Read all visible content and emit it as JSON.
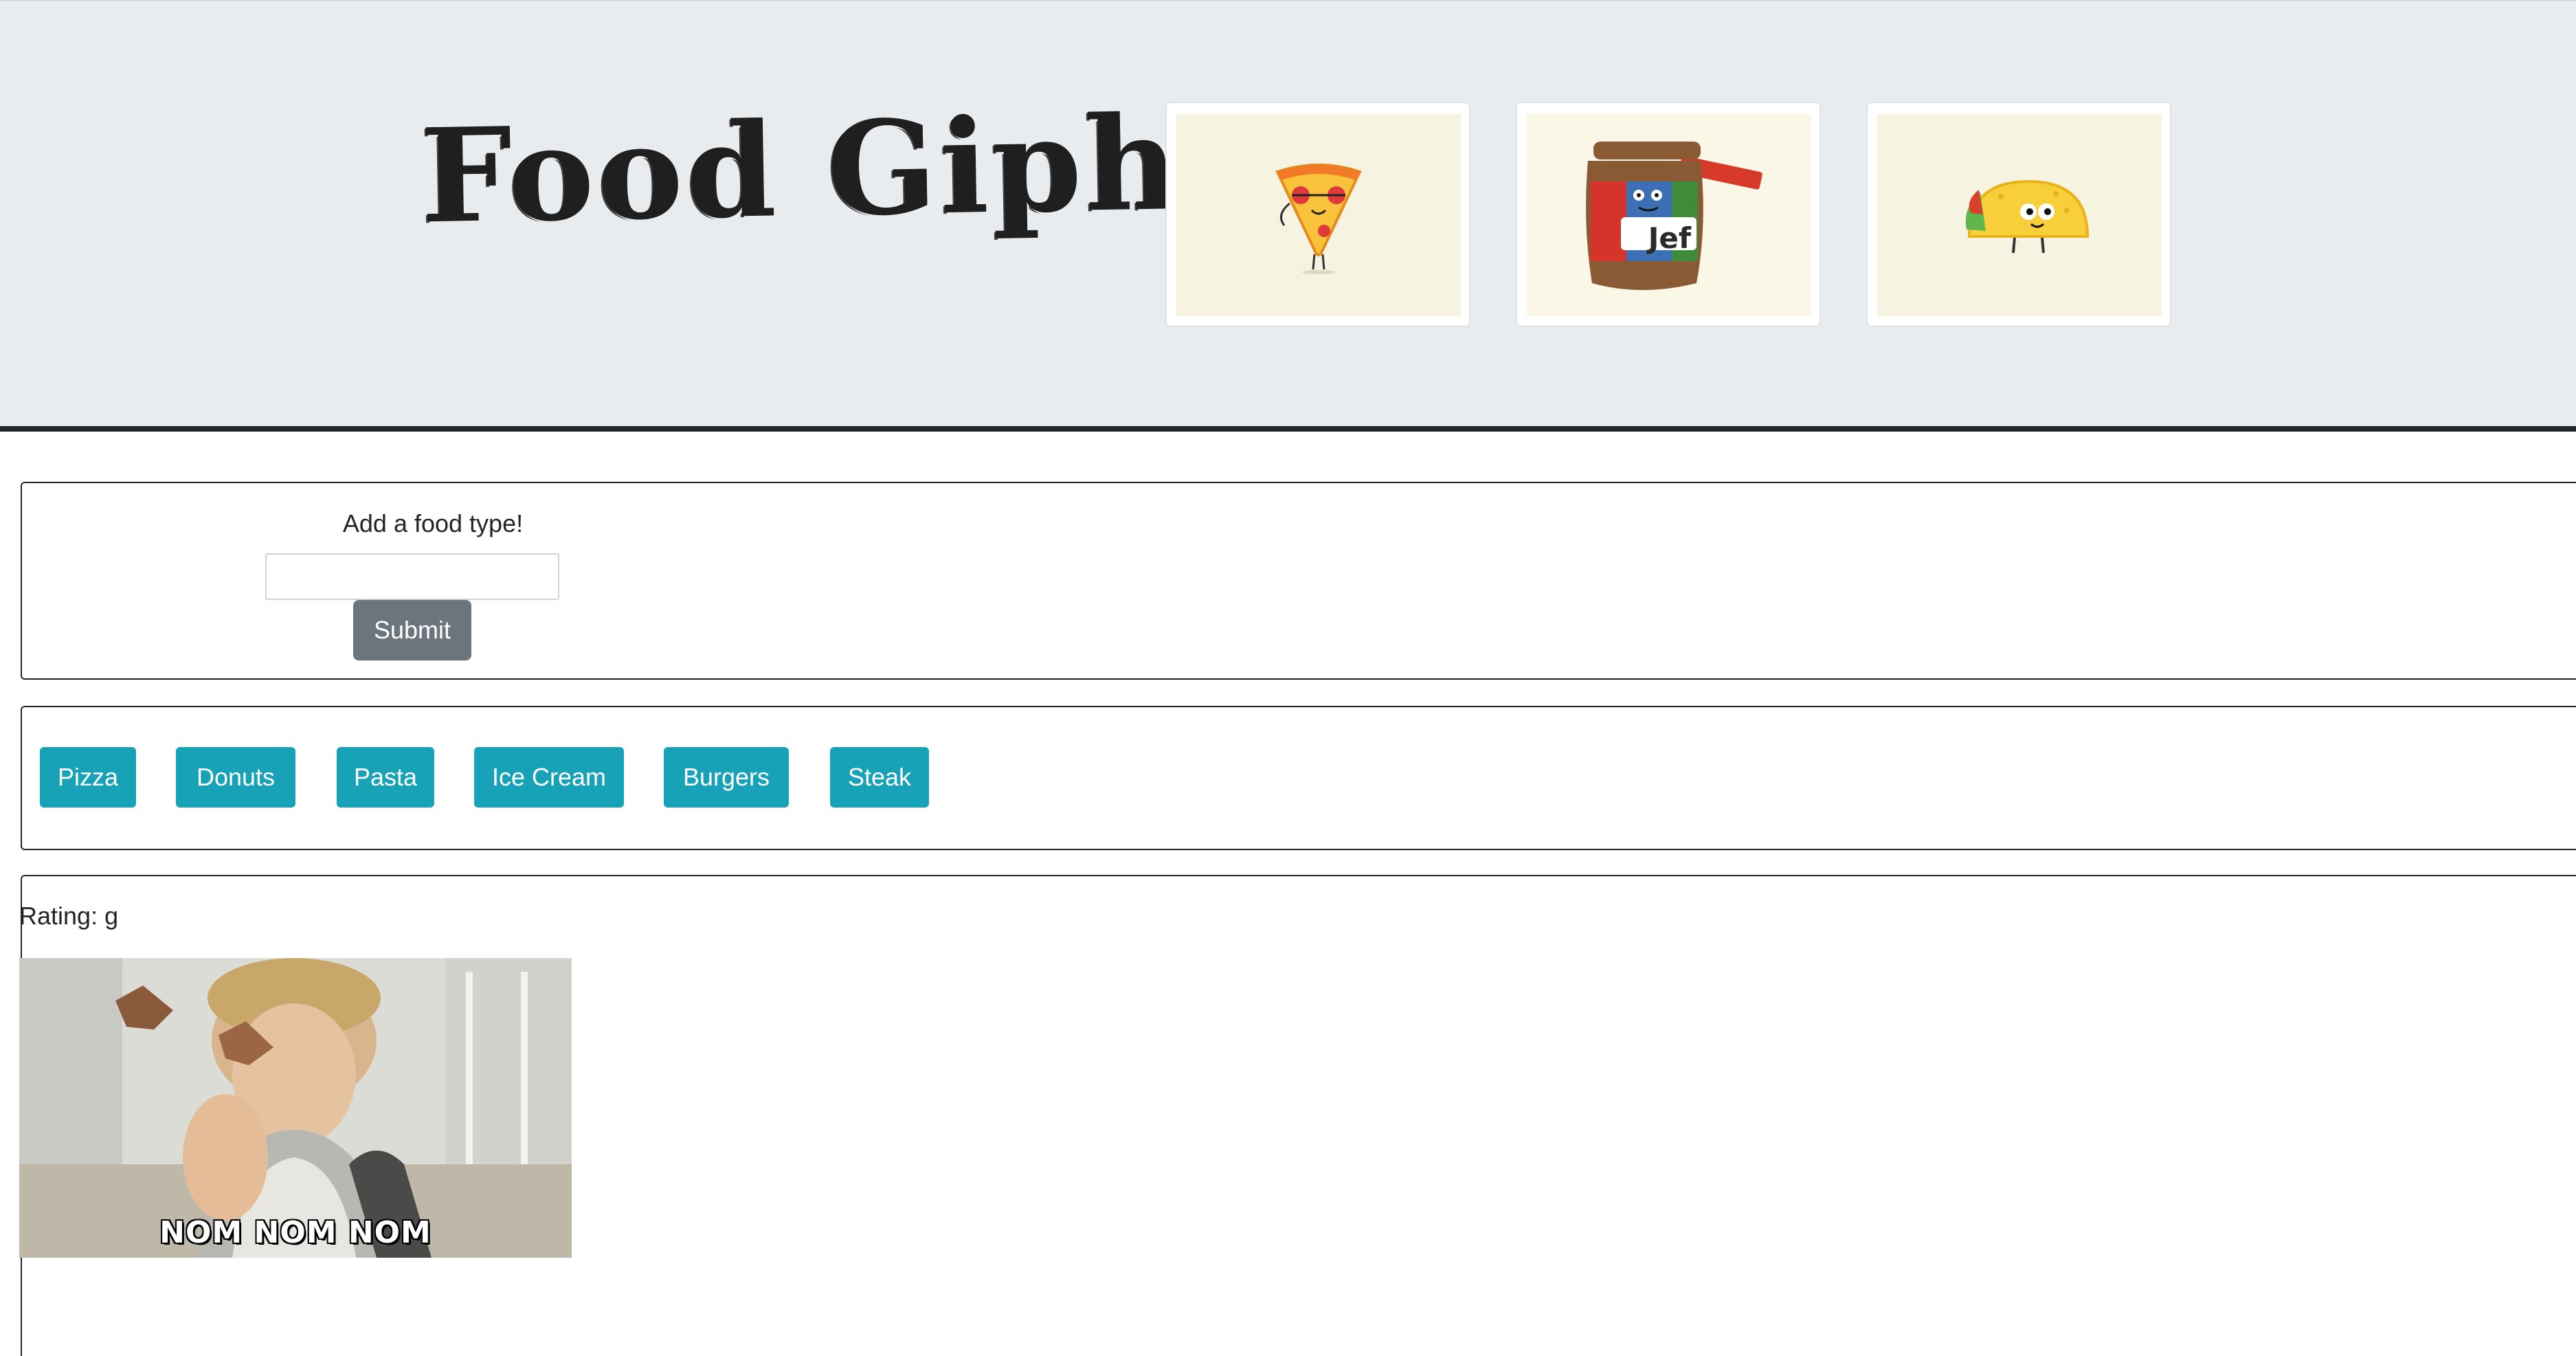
{
  "header": {
    "title": "Food Giphy!",
    "thumbnails": [
      {
        "icon": "pizza-slice-character-icon"
      },
      {
        "icon": "peanut-butter-jar-character-icon",
        "label": "Jef"
      },
      {
        "icon": "taco-character-icon"
      }
    ]
  },
  "form": {
    "label": "Add a food type!",
    "input_value": "",
    "input_placeholder": "",
    "submit_label": "Submit"
  },
  "food_buttons": [
    "Pizza",
    "Donuts",
    "Pasta",
    "Ice Cream",
    "Burgers",
    "Steak"
  ],
  "results": [
    {
      "rating": "Rating: g",
      "caption": "NOM NOM NOM"
    }
  ],
  "colors": {
    "jumbotron_bg": "#e9ecef",
    "food_button": "#17a2b8",
    "submit_button": "#6c757d",
    "border": "#212529"
  }
}
